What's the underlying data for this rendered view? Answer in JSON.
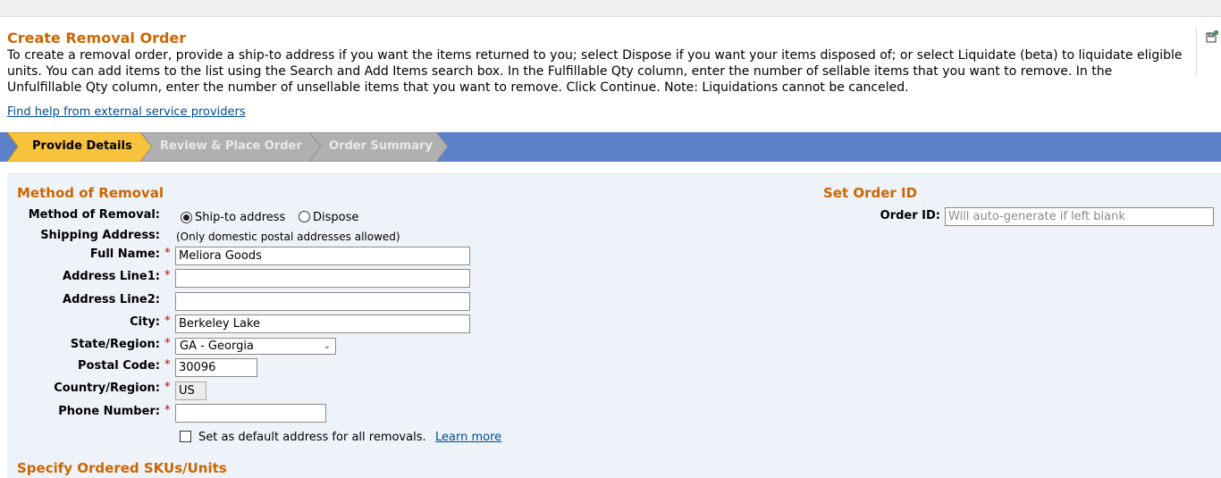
{
  "header": {
    "title": "Create Removal Order",
    "intro": "To create a removal order, provide a ship-to address if you want the items returned to you; select Dispose if you want your items disposed of; or select Liquidate (beta) to liquidate eligible units. You can add items to the list using the Search and Add Items search box. In the Fulfillable Qty column, enter the number of sellable items that you want to remove. In the Unfulfillable Qty column, enter the number of unsellable items that you want to remove. Click Continue. Note: Liquidations cannot be canceled.",
    "help_link": "Find help from external service providers"
  },
  "steps": [
    {
      "label": "Provide Details",
      "active": true
    },
    {
      "label": "Review & Place Order",
      "active": false
    },
    {
      "label": "Order Summary",
      "active": false
    }
  ],
  "removal": {
    "section_title": "Method of Removal",
    "method_label": "Method of Removal:",
    "options": [
      {
        "label": "Ship-to address",
        "selected": true
      },
      {
        "label": "Dispose",
        "selected": false
      }
    ],
    "shipping_label": "Shipping Address:",
    "shipping_note": "(Only domestic postal addresses allowed)",
    "required_mark": "*",
    "fields": {
      "full_name": {
        "label": "Full Name:",
        "value": "Meliora Goods"
      },
      "address1": {
        "label": "Address Line1:",
        "value": ""
      },
      "address2": {
        "label": "Address Line2:",
        "value": ""
      },
      "city": {
        "label": "City:",
        "value": "Berkeley Lake"
      },
      "state": {
        "label": "State/Region:",
        "value": "GA - Georgia"
      },
      "postal": {
        "label": "Postal Code:",
        "value": "30096"
      },
      "country": {
        "label": "Country/Region:",
        "value": "US"
      },
      "phone": {
        "label": "Phone Number:",
        "value": ""
      }
    },
    "default_checkbox": {
      "label": "Set as default address for all removals.",
      "checked": false,
      "link": "Learn more"
    }
  },
  "order_id": {
    "section_title": "Set Order ID",
    "label": "Order ID:",
    "placeholder": "Will auto-generate if left blank",
    "value": ""
  },
  "next_section": {
    "title": "Specify Ordered SKUs/Units"
  },
  "colors": {
    "accent": "#cc6600",
    "step_bar": "#5b7fc9",
    "step_active": "#f7c23c",
    "link": "#004b91",
    "required": "#cc0000"
  },
  "icons": {
    "corner": "save-export-icon"
  }
}
